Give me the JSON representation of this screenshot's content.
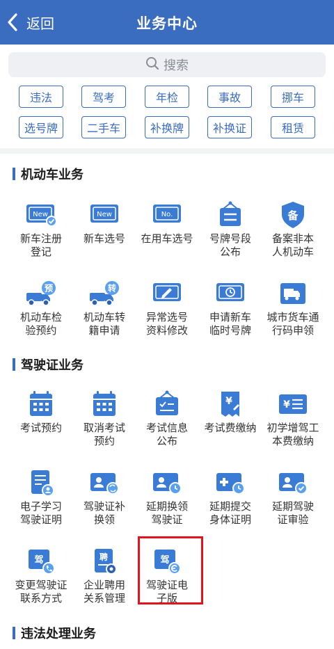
{
  "header": {
    "back_label": "返回",
    "title": "业务中心"
  },
  "search": {
    "placeholder": "搜索"
  },
  "tags": [
    "违法",
    "驾考",
    "年检",
    "事故",
    "挪车",
    "选号牌",
    "二手车",
    "补换牌",
    "补换证",
    "租赁"
  ],
  "sections": {
    "motor": {
      "title": "机动车业务",
      "items": [
        {
          "label": "新车注册\n登记",
          "icon": "new-plate-check-icon",
          "badge": "New"
        },
        {
          "label": "新车选号",
          "icon": "new-plate-icon",
          "badge": "New"
        },
        {
          "label": "在用车选号",
          "icon": "plate-number-icon",
          "badge": "No."
        },
        {
          "label": "号牌号段\n公布",
          "icon": "announcement-board-icon"
        },
        {
          "label": "备案非本\n人机动车",
          "icon": "record-shield-icon",
          "badge": "备"
        },
        {
          "label": "机动车检\n验预约",
          "icon": "truck-inspection-icon",
          "badge": "预"
        },
        {
          "label": "机动车转\n籍申请",
          "icon": "truck-transfer-icon",
          "badge": "转"
        },
        {
          "label": "异常选号\n资料修改",
          "icon": "edit-plate-icon"
        },
        {
          "label": "申请新车\n临时号牌",
          "icon": "temporary-plate-clock-icon"
        },
        {
          "label": "城市货车通\n行码申领",
          "icon": "city-truck-pass-icon"
        }
      ]
    },
    "license": {
      "title": "驾驶证业务",
      "items": [
        {
          "label": "考试预约",
          "icon": "calendar-icon"
        },
        {
          "label": "取消考试\n预约",
          "icon": "calendar-cancel-icon"
        },
        {
          "label": "考试信息\n公布",
          "icon": "exam-board-icon"
        },
        {
          "label": "考试费缴纳",
          "icon": "fee-receipt-icon",
          "badge": "¥"
        },
        {
          "label": "初学增驾工\n本费缴纳",
          "icon": "fee-card-icon",
          "badge": "¥"
        },
        {
          "label": "电子学习\n驾驶证明",
          "icon": "document-person-icon"
        },
        {
          "label": "驾驶证补\n换领",
          "icon": "license-reissue-icon"
        },
        {
          "label": "延期换领\n驾驶证",
          "icon": "license-extend-clock-icon"
        },
        {
          "label": "延期提交\n身体证明",
          "icon": "health-cert-clock-icon"
        },
        {
          "label": "延期驾驶\n证审验",
          "icon": "license-check-icon"
        },
        {
          "label": "变更驾驶证\n联系方式",
          "icon": "license-phone-icon",
          "badge": "驾"
        },
        {
          "label": "企业聘用\n关系管理",
          "icon": "employment-doc-icon",
          "badge": "聘"
        },
        {
          "label": "驾驶证电\n子版",
          "icon": "electronic-license-icon",
          "badge": "驾"
        }
      ]
    },
    "violation": {
      "title": "违法处理业务"
    }
  }
}
